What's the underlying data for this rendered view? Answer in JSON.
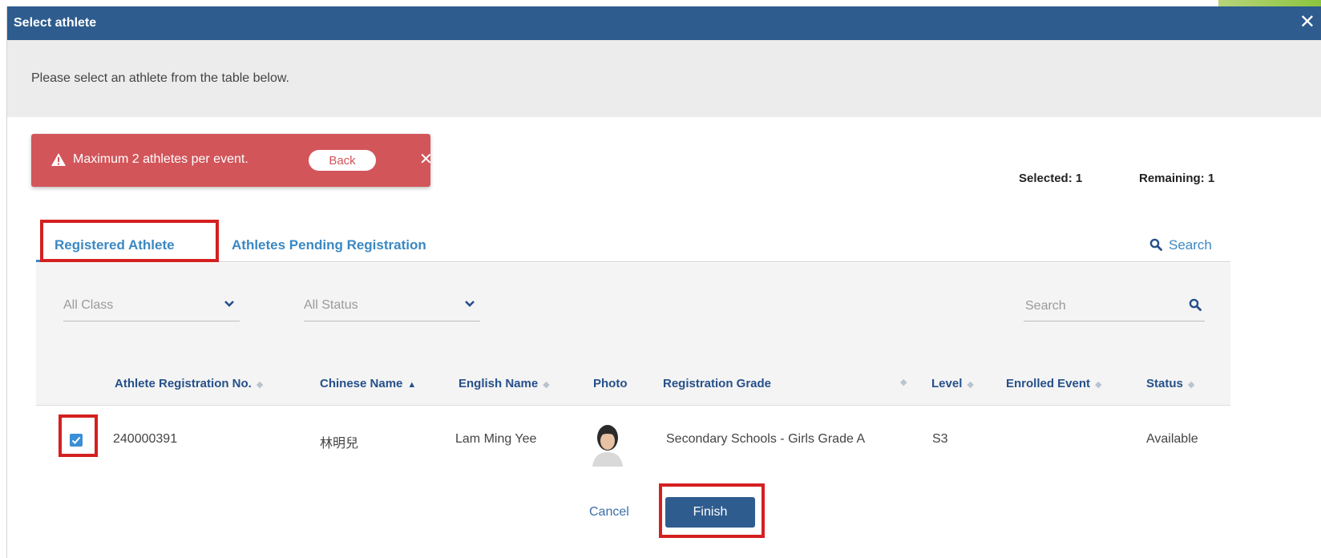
{
  "dialog": {
    "title": "Select athlete",
    "close_icon": "close-icon",
    "instruction": "Please select an athlete from the table below."
  },
  "alert": {
    "message": "Maximum 2 athletes per event.",
    "back_label": "Back",
    "close_symbol": "✕",
    "icon": "warning-icon",
    "color": "#d2555a"
  },
  "counters": {
    "selected": "Selected: 1",
    "remaining": "Remaining: 1"
  },
  "tabs": [
    {
      "label": "Registered Athlete",
      "active": true
    },
    {
      "label": "Athletes Pending Registration",
      "active": false
    }
  ],
  "search_link": {
    "label": "Search",
    "icon": "search-icon"
  },
  "filters": {
    "class_label": "All Class",
    "status_label": "All Status",
    "search_placeholder": "Search"
  },
  "table": {
    "columns": [
      {
        "label": "Athlete Registration No.",
        "sort": "none"
      },
      {
        "label": "Chinese Name",
        "sort": "asc"
      },
      {
        "label": "English Name",
        "sort": "none"
      },
      {
        "label": "Photo",
        "sort": null
      },
      {
        "label": "Registration Grade",
        "sort": "none"
      },
      {
        "label": "Level",
        "sort": "none"
      },
      {
        "label": "Enrolled Event",
        "sort": "none"
      },
      {
        "label": "Status",
        "sort": "none"
      }
    ],
    "rows": [
      {
        "selected": true,
        "reg_no": "240000391",
        "chinese_name": "林明兒",
        "english_name": "Lam Ming Yee",
        "photo_icon": "athlete-photo",
        "grade": "Secondary Schools - Girls Grade A",
        "level": "S3",
        "enrolled_event": "",
        "status": "Available"
      }
    ]
  },
  "footer": {
    "cancel_label": "Cancel",
    "finish_label": "Finish"
  },
  "colors": {
    "header": "#2e5c8e",
    "accent": "#3b88c3",
    "highlight": "#d42020",
    "checkbox": "#3a8fd6"
  }
}
